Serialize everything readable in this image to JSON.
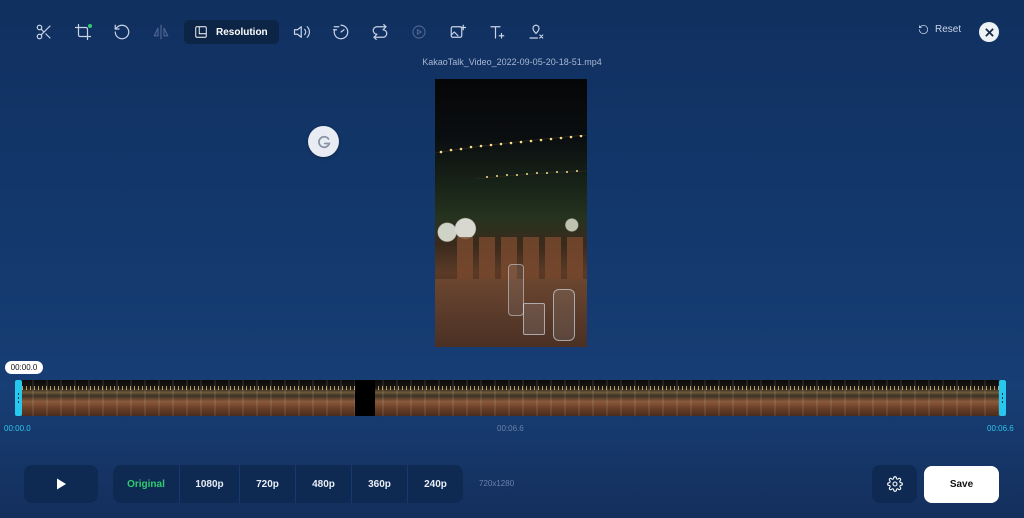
{
  "toolbar": {
    "tools": [
      {
        "icon": "scissors-icon"
      },
      {
        "icon": "crop-icon",
        "has_dot": true
      },
      {
        "icon": "rotate-icon"
      },
      {
        "icon": "flip-icon",
        "disabled": true
      }
    ],
    "active_tool": {
      "icon": "resolution-icon",
      "label": "Resolution"
    },
    "tools_after": [
      {
        "icon": "volume-icon"
      },
      {
        "icon": "speed-icon"
      },
      {
        "icon": "loop-icon"
      },
      {
        "icon": "reverse-icon",
        "disabled": true
      },
      {
        "icon": "add-image-icon"
      },
      {
        "icon": "text-icon"
      },
      {
        "icon": "remove-watermark-icon"
      }
    ],
    "reset_label": "Reset"
  },
  "filename": "KakaoTalk_Video_2022-09-05-20-18-51.mp4",
  "timeline": {
    "current_time": "00:00.0",
    "start_time": "00:00.0",
    "mid_time": "00:06.6",
    "end_time": "00:06.6"
  },
  "controls": {
    "resolutions": [
      {
        "label": "Original",
        "active": true
      },
      {
        "label": "1080p"
      },
      {
        "label": "720p"
      },
      {
        "label": "480p"
      },
      {
        "label": "360p"
      },
      {
        "label": "240p"
      }
    ],
    "dimensions": "720x1280",
    "save_label": "Save"
  },
  "colors": {
    "accent_green": "#2ecc71",
    "timeline_handle": "#27c8ee",
    "background": "#143a70"
  }
}
